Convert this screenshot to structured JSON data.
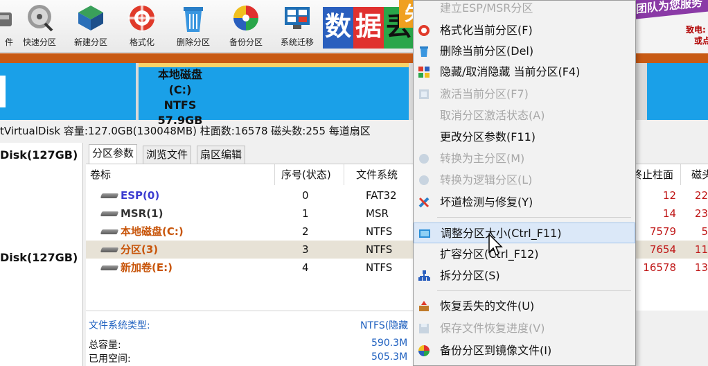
{
  "toolbar": {
    "buttons": [
      {
        "id": "unknown",
        "label": "件"
      },
      {
        "id": "quick",
        "label": "快速分区"
      },
      {
        "id": "new",
        "label": "新建分区"
      },
      {
        "id": "format",
        "label": "格式化"
      },
      {
        "id": "delete",
        "label": "删除分区"
      },
      {
        "id": "backup",
        "label": "备份分区"
      },
      {
        "id": "migrate",
        "label": "系统迁移"
      }
    ]
  },
  "ad_banner": {
    "chars": [
      "数",
      "据",
      "丢",
      "失"
    ],
    "colors": [
      "#2a5fbe",
      "#e0312f",
      "#2aa64a",
      "#f0a020"
    ]
  },
  "ad_right": {
    "ribbon": "团队为您服务",
    "line1": "致电:",
    "line2": "或点"
  },
  "disk_map": {
    "partition_c": {
      "name": "本地磁盘(C:)",
      "fs": "NTFS",
      "size": "57.9GB"
    }
  },
  "disk_info": "tVirtualDisk  容量:127.0GB(130048MB)  柱面数:16578  磁头数:255  每道扇区",
  "tree": {
    "disks": [
      "Disk(127GB)",
      "Disk(127GB)"
    ]
  },
  "tabs": [
    "分区参数",
    "浏览文件",
    "扇区编辑"
  ],
  "table": {
    "headers": {
      "label": "卷标",
      "index": "序号(状态)",
      "fs": "文件系统",
      "end_cyl": "终止柱面",
      "heads": "磁头"
    },
    "rows": [
      {
        "name": "ESP(0)",
        "index": "0",
        "fs": "FAT32",
        "end": "12",
        "head": "22",
        "color": "blue"
      },
      {
        "name": "MSR(1)",
        "index": "1",
        "fs": "MSR",
        "end": "14",
        "head": "23",
        "color": "plain"
      },
      {
        "name": "本地磁盘(C:)",
        "index": "2",
        "fs": "NTFS",
        "end": "7579",
        "head": "5",
        "color": "orange"
      },
      {
        "name": "分区(3)",
        "index": "3",
        "fs": "NTFS",
        "end": "7654",
        "head": "11",
        "color": "orange"
      },
      {
        "name": "新加卷(E:)",
        "index": "4",
        "fs": "NTFS",
        "end": "16578",
        "head": "13",
        "color": "orange"
      }
    ]
  },
  "info_panel": {
    "fs_type_label": "文件系统类型:",
    "fs_type_value": "NTFS(隐藏",
    "total_label": "总容量:",
    "total_value": "590.3M",
    "used_label": "已用空间:",
    "used_value": "505.3M"
  },
  "context_menu": {
    "items": [
      {
        "label": "建立ESP/MSR分区",
        "disabled": true,
        "icon": "esp-icon"
      },
      {
        "label": "格式化当前分区(F)",
        "disabled": false,
        "icon": "format-icon"
      },
      {
        "label": "删除当前分区(Del)",
        "disabled": false,
        "icon": "delete-icon"
      },
      {
        "label": "隐藏/取消隐藏 当前分区(F4)",
        "disabled": false,
        "icon": "hide-icon"
      },
      {
        "label": "激活当前分区(F7)",
        "disabled": true,
        "icon": "activate-icon"
      },
      {
        "label": "取消分区激活状态(A)",
        "disabled": true,
        "icon": "none"
      },
      {
        "label": "更改分区参数(F11)",
        "disabled": false,
        "icon": "none"
      },
      {
        "label": "转换为主分区(M)",
        "disabled": true,
        "icon": "convert-primary-icon"
      },
      {
        "label": "转换为逻辑分区(L)",
        "disabled": true,
        "icon": "convert-logical-icon"
      },
      {
        "label": "坏道检测与修复(Y)",
        "disabled": false,
        "icon": "repair-icon"
      },
      {
        "label": "调整分区大小(Ctrl_F11)",
        "disabled": false,
        "icon": "resize-icon",
        "highlighted": true
      },
      {
        "label": "扩容分区(Ctrl_F12)",
        "disabled": false,
        "icon": "none"
      },
      {
        "label": "拆分分区(S)",
        "disabled": false,
        "icon": "split-icon"
      },
      {
        "label": "恢复丢失的文件(U)",
        "disabled": false,
        "icon": "recover-icon"
      },
      {
        "label": "保存文件恢复进度(V)",
        "disabled": true,
        "icon": "save-icon"
      },
      {
        "label": "备份分区到镜像文件(I)",
        "disabled": false,
        "icon": "backup-image-icon"
      }
    ]
  }
}
